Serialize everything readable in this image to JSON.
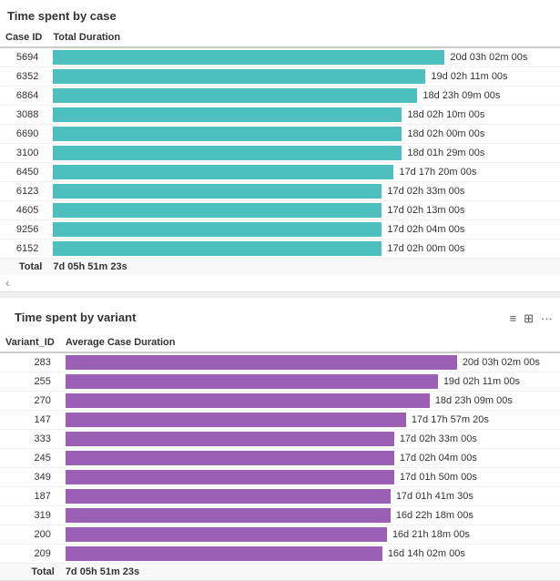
{
  "section1": {
    "title": "Time spent by case",
    "columns": {
      "col1": "Case ID",
      "col2": "Total Duration"
    },
    "rows": [
      {
        "id": "5694",
        "duration": "20d 03h 02m 00s",
        "barPct": 100
      },
      {
        "id": "6352",
        "duration": "19d 02h 11m 00s",
        "barPct": 95
      },
      {
        "id": "6864",
        "duration": "18d 23h 09m 00s",
        "barPct": 93
      },
      {
        "id": "3088",
        "duration": "18d 02h 10m 00s",
        "barPct": 89
      },
      {
        "id": "6690",
        "duration": "18d 02h 00m 00s",
        "barPct": 89
      },
      {
        "id": "3100",
        "duration": "18d 01h 29m 00s",
        "barPct": 89
      },
      {
        "id": "6450",
        "duration": "17d 17h 20m 00s",
        "barPct": 87
      },
      {
        "id": "6123",
        "duration": "17d 02h 33m 00s",
        "barPct": 84
      },
      {
        "id": "4605",
        "duration": "17d 02h 13m 00s",
        "barPct": 84
      },
      {
        "id": "9256",
        "duration": "17d 02h 04m 00s",
        "barPct": 84
      },
      {
        "id": "6152",
        "duration": "17d 02h 00m 00s",
        "barPct": 84
      }
    ],
    "total_label": "Total",
    "total_value": "7d 05h 51m 23s"
  },
  "section2": {
    "title": "Time spent by variant",
    "columns": {
      "col1": "Variant_ID",
      "col2": "Average Case Duration"
    },
    "rows": [
      {
        "id": "283",
        "duration": "20d 03h 02m 00s",
        "barPct": 100
      },
      {
        "id": "255",
        "duration": "19d 02h 11m 00s",
        "barPct": 95
      },
      {
        "id": "270",
        "duration": "18d 23h 09m 00s",
        "barPct": 93
      },
      {
        "id": "147",
        "duration": "17d 17h 57m 20s",
        "barPct": 87
      },
      {
        "id": "333",
        "duration": "17d 02h 33m 00s",
        "barPct": 84
      },
      {
        "id": "245",
        "duration": "17d 02h 04m 00s",
        "barPct": 84
      },
      {
        "id": "349",
        "duration": "17d 01h 50m 00s",
        "barPct": 84
      },
      {
        "id": "187",
        "duration": "17d 01h 41m 30s",
        "barPct": 83
      },
      {
        "id": "319",
        "duration": "16d 22h 18m 00s",
        "barPct": 83
      },
      {
        "id": "200",
        "duration": "16d 21h 18m 00s",
        "barPct": 82
      },
      {
        "id": "209",
        "duration": "16d 14h 02m 00s",
        "barPct": 81
      }
    ],
    "total_label": "Total",
    "total_value": "7d 05h 51m 23s",
    "icons": {
      "filter": "≡",
      "expand": "⊞",
      "more": "···"
    }
  }
}
